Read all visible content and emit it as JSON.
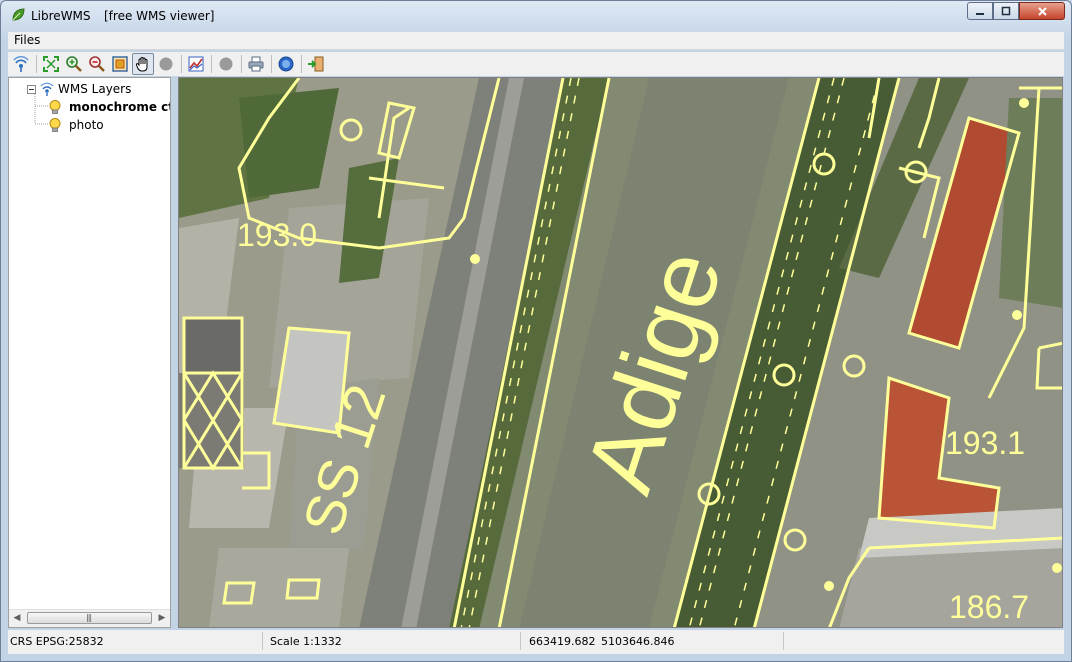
{
  "window": {
    "app_title": "LibreWMS",
    "doc_title": "[free WMS viewer]",
    "controls": {
      "minimize": "▁",
      "maximize": "▢",
      "close": "✕"
    }
  },
  "menu": {
    "items": [
      {
        "label": "Files"
      }
    ]
  },
  "toolbar": {
    "buttons": [
      {
        "name": "connect-icon",
        "color": "#2f6fbf"
      },
      {
        "name": "zoom-extent-icon",
        "color": "#2c9c2c"
      },
      {
        "name": "zoom-in-icon",
        "color": "#2c9c2c"
      },
      {
        "name": "zoom-out-icon",
        "color": "#d03030"
      },
      {
        "name": "zoom-box-icon",
        "color": "#e0a020"
      },
      {
        "name": "pan-hand-icon",
        "active": true
      },
      {
        "name": "disabled-circle-icon",
        "color": "#9a9a9a"
      },
      {
        "name": "chart-icon",
        "color": "#3a60c0"
      },
      {
        "name": "disabled-circle-icon",
        "color": "#9a9a9a"
      },
      {
        "name": "print-icon",
        "color": "#5a6a80"
      },
      {
        "name": "help-icon",
        "color": "#2a68c8"
      },
      {
        "name": "exit-icon",
        "color": "#3aa03a"
      }
    ]
  },
  "layers": {
    "root_label": "WMS Layers",
    "items": [
      {
        "label": "monochrome ct",
        "bold": true
      },
      {
        "label": "photo",
        "bold": false
      }
    ]
  },
  "map": {
    "labels": {
      "river": "Adige",
      "road": "SS 12",
      "elev_1": "193.0",
      "elev_2": "193.1",
      "elev_3": "186.7"
    },
    "overlay_color": "#ffff9a"
  },
  "status": {
    "crs": "CRS EPSG:25832",
    "scale": "Scale 1:1332",
    "x": "663419.682",
    "y": "5103646.846"
  }
}
